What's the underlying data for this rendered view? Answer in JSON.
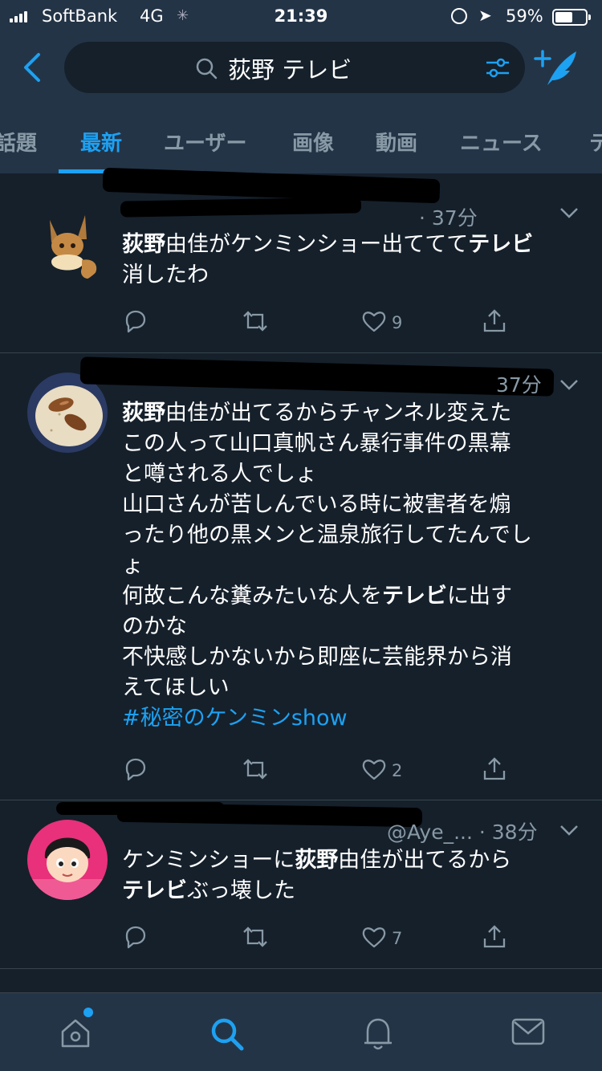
{
  "status_bar": {
    "carrier": "SoftBank",
    "network": "4G",
    "time": "21:39",
    "battery": "59%",
    "battery_level": 0.59
  },
  "search": {
    "query": "荻野 テレビ"
  },
  "tabs": [
    "話題",
    "最新",
    "ユーザー",
    "画像",
    "動画",
    "ニュース",
    "テ"
  ],
  "active_tab": "最新",
  "tweets": [
    {
      "time": "· 37分",
      "avatar": "eevee-avatar",
      "body_lines": [
        [
          {
            "t": "荻野",
            "b": true
          },
          {
            "t": "由佳がケンミンショー出ててて"
          },
          {
            "t": "テレビ",
            "b": true
          }
        ],
        [
          {
            "t": "消したわ"
          }
        ]
      ],
      "replies": "",
      "retweets": "",
      "likes": "9"
    },
    {
      "time": "37分",
      "avatar": "almond-cracker-avatar",
      "body_lines": [
        [
          {
            "t": "荻野",
            "b": true
          },
          {
            "t": "由佳が出てるからチャンネル変えた"
          }
        ],
        [
          {
            "t": "この人って山口真帆さん暴行事件の黒幕"
          }
        ],
        [
          {
            "t": "と噂される人でしょ"
          }
        ],
        [
          {
            "t": "山口さんが苦しんでいる時に被害者を煽"
          }
        ],
        [
          {
            "t": "ったり他の黒メンと温泉旅行してたんでし"
          }
        ],
        [
          {
            "t": "ょ"
          }
        ],
        [
          {
            "t": "何故こんな糞みたいな人を"
          },
          {
            "t": "テレビ",
            "b": true
          },
          {
            "t": "に出す"
          }
        ],
        [
          {
            "t": "のかな"
          }
        ],
        [
          {
            "t": "不快感しかないから即座に芸能界から消"
          }
        ],
        [
          {
            "t": "えてほしい"
          }
        ],
        [
          {
            "t": "#秘密のケンミンshow",
            "tag": true
          }
        ]
      ],
      "replies": "",
      "retweets": "",
      "likes": "2"
    },
    {
      "time": "@Aye_... · 38分",
      "avatar": "chiko-chan-avatar",
      "body_lines": [
        [
          {
            "t": "ケンミンショーに"
          },
          {
            "t": "荻野",
            "b": true
          },
          {
            "t": "由佳が出てるから"
          }
        ],
        [
          {
            "t": "テレビ",
            "b": true
          },
          {
            "t": "ぶっ壊した"
          }
        ]
      ],
      "replies": "",
      "retweets": "",
      "likes": "7"
    }
  ],
  "bottom_nav": [
    "home-icon",
    "search-icon",
    "notifications-icon",
    "messages-icon"
  ],
  "colors": {
    "background": "#15202b",
    "header": "#243447",
    "accent": "#1da1f2",
    "secondary_text": "#8899a6",
    "divider": "#38444d"
  }
}
